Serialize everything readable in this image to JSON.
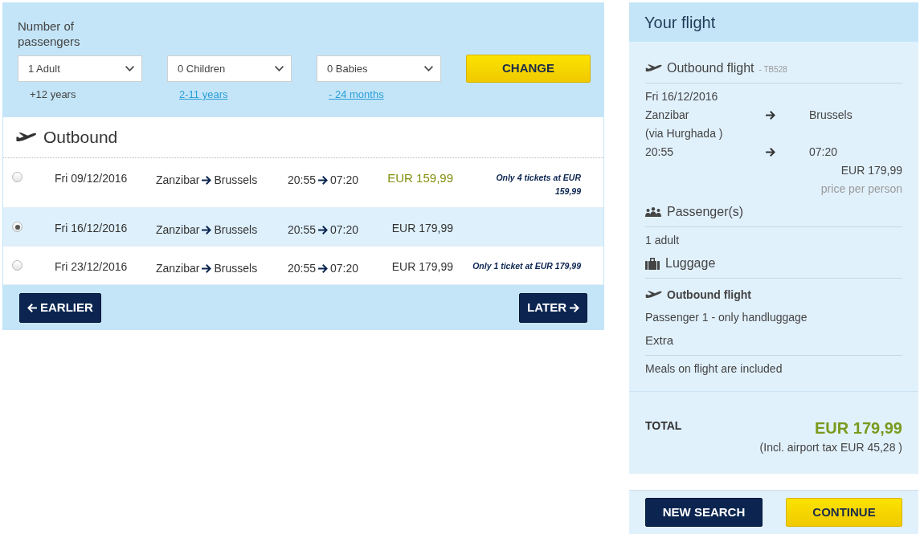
{
  "passengers": {
    "title": "Number of passengers",
    "selects": [
      {
        "value": "1 Adult",
        "hint": "+12 years",
        "kind": "text"
      },
      {
        "value": "0 Children",
        "hint": "2-11 years",
        "kind": "link"
      },
      {
        "value": "0 Babies",
        "hint": "- 24 months",
        "kind": "link"
      }
    ],
    "button": "CHANGE"
  },
  "outbound": {
    "title": "Outbound",
    "flights": [
      {
        "selected": false,
        "date": "Fri 09/12/2016",
        "from": "Zanzibar",
        "to": "Brussels",
        "depart": "20:55",
        "arrive": "07:20",
        "price": "EUR 159,99",
        "highlighted": true,
        "note": "Only 4 tickets at EUR 159,99"
      },
      {
        "selected": true,
        "date": "Fri 16/12/2016",
        "from": "Zanzibar",
        "to": "Brussels",
        "depart": "20:55",
        "arrive": "07:20",
        "price": "EUR 179,99",
        "highlighted": false
      },
      {
        "selected": false,
        "date": "Fri 23/12/2016",
        "from": "Zanzibar",
        "to": "Brussels",
        "depart": "20:55",
        "arrive": "07:20",
        "price": "EUR 179,99",
        "highlighted": false,
        "note": "Only 1 ticket at EUR 179,99"
      }
    ],
    "nav_buttons": [
      {
        "label": "EARLIER",
        "kind": "back"
      },
      {
        "label": "LATER",
        "kind": "forward"
      }
    ]
  },
  "summary": {
    "title": "Your flight",
    "flight": {
      "heading": "Outbound flight",
      "code": "- TB528",
      "date": "Fri 16/12/2016",
      "from": "Zanzibar",
      "to": "Brussels",
      "via": "(via Hurghada )",
      "depart": "20:55",
      "arrive": "07:20",
      "price": "EUR 179,99",
      "price_note": "price per person"
    },
    "sections": [
      {
        "kind": "passengers",
        "heading": "Passenger(s)",
        "lines": [
          "1 adult"
        ]
      },
      {
        "kind": "luggage",
        "heading": "Luggage",
        "subheading": "Outbound flight",
        "lines": [
          "Passenger 1 - only handluggage"
        ]
      },
      {
        "kind": "extra",
        "heading": "Extra",
        "lines": [
          "Meals on flight are included"
        ]
      }
    ],
    "total": {
      "label": "TOTAL",
      "amount": "EUR 179,99",
      "tax_note": "(Incl. airport tax EUR 45,28 )"
    },
    "buttons": [
      {
        "label": "NEW SEARCH",
        "kind": "secondary"
      },
      {
        "label": "CONTINUE",
        "kind": "primary"
      }
    ]
  }
}
